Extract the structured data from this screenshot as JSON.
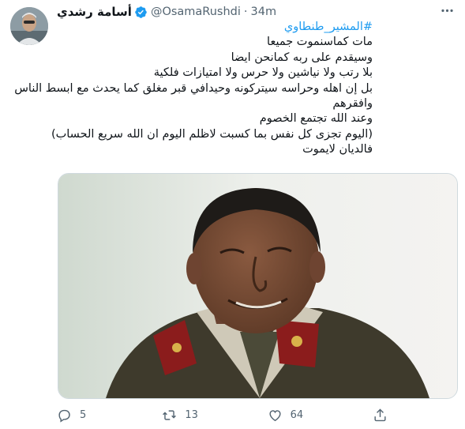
{
  "tweet": {
    "display_name": "أسامة رشدي",
    "handle": "@OsamaRushdi",
    "separator": "·",
    "time": "34m",
    "text_lines": [
      "#المشير_طنطاوي",
      "مات كماسنموت جميعا",
      "وسيقدم على ربه كمانحن ايضا",
      "بلا رتب ولا نياشين ولا حرس ولا امتيازات فلكية",
      "بل إن اهله وحراسه سيتركونه وحيدافي قبر مغلق كما يحدث مع ابسط الناس",
      "وافقرهم",
      "وعند الله تجتمع الخصوم",
      "(اليوم تجزى كل نفس بما كسبت لاظلم اليوم ان الله سريع الحساب)",
      "فالديان لايموت"
    ],
    "media_alt": "photo",
    "actions": {
      "reply_count": "5",
      "retweet_count": "13",
      "like_count": "64"
    }
  },
  "colors": {
    "accent": "#1d9bf0",
    "secondary_text": "#536471",
    "primary_text": "#0f1419"
  },
  "icons": [
    "verified-badge-icon",
    "more-icon",
    "reply-icon",
    "retweet-icon",
    "like-icon",
    "share-icon"
  ]
}
